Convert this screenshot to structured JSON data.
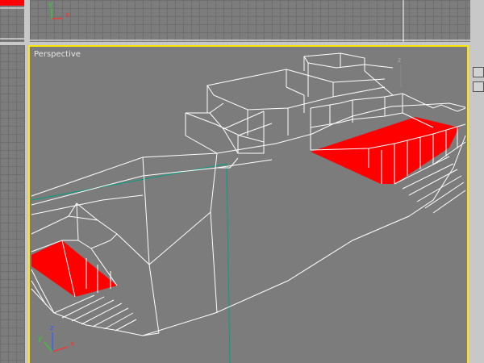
{
  "viewports": {
    "perspective": {
      "label": "Perspective",
      "active": true,
      "border_color": "#ffe600"
    }
  },
  "axis_labels": {
    "x": "x",
    "y": "y",
    "z": "z"
  },
  "colors": {
    "background": "#7c7c7c",
    "wireframe": "#ffffff",
    "selected_faces": "#ff0000",
    "axis_x": "#ff3030",
    "axis_y": "#30d030",
    "axis_z": "#3060ff",
    "guide_line": "#00a080"
  },
  "icons": {
    "top_viewport_axis": "axis-tripod-icon",
    "perspective_axis": "axis-tripod-icon",
    "side_buttons": [
      "viewport-control-icon",
      "viewport-control-icon"
    ]
  }
}
